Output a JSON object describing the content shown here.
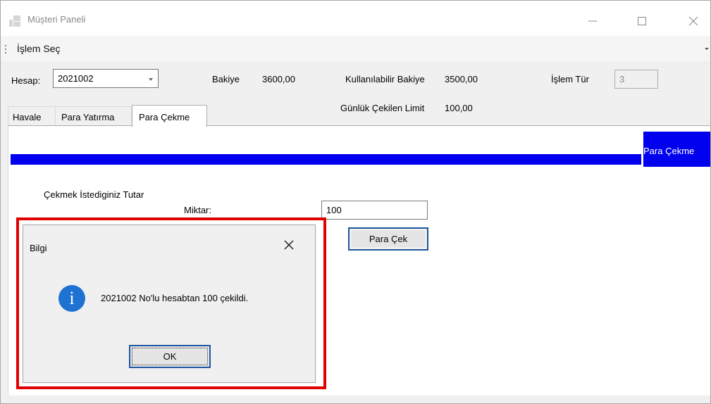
{
  "window": {
    "title": "Müşteri Paneli",
    "minimize_icon": "minimize-icon",
    "maximize_icon": "maximize-icon",
    "close_icon": "close-icon"
  },
  "menu": {
    "item": "İşlem Seç"
  },
  "account": {
    "label": "Hesap:",
    "selected": "2021002",
    "balance_label": "Bakiye",
    "balance_value": "3600,00",
    "available_label": "Kullanılabilir Bakiye",
    "available_value": "3500,00",
    "type_label": "İşlem Tür",
    "type_value": "3",
    "daily_limit_label": "Günlük Çekilen Limit",
    "daily_limit_value": "100,00"
  },
  "tabs": [
    {
      "label": "Havale"
    },
    {
      "label": "Para Yatırma"
    },
    {
      "label": "Para Çekme"
    }
  ],
  "panel": {
    "header": "Para Çekme",
    "section_label": "Çekmek İstediginiz Tutar",
    "amount_label": "Miktar:",
    "amount_value": "100",
    "submit_label": "Para Çek"
  },
  "dialog": {
    "title": "Bilgi",
    "message": "2021002 No'lu hesabtan 100 çekildi.",
    "ok_label": "OK"
  },
  "colors": {
    "accent_blue": "#0000ee",
    "highlight_red": "#e00000",
    "info_icon_blue": "#1e73d2",
    "focus_border": "#1f57a0"
  }
}
